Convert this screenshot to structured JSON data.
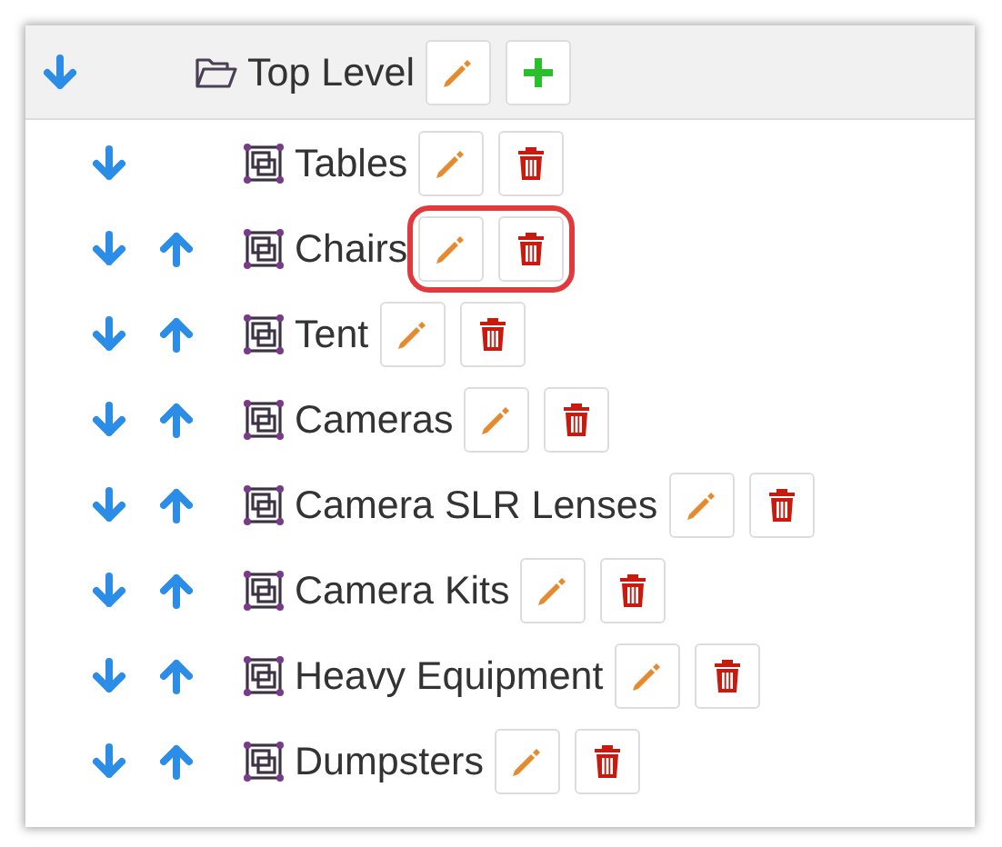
{
  "root": {
    "label": "Top Level",
    "expanded": true,
    "items": [
      {
        "label": "Tables",
        "can_move_up": false,
        "highlighted": false
      },
      {
        "label": "Chairs",
        "can_move_up": true,
        "highlighted": true
      },
      {
        "label": "Tent",
        "can_move_up": true,
        "highlighted": false
      },
      {
        "label": "Cameras",
        "can_move_up": true,
        "highlighted": false
      },
      {
        "label": "Camera SLR Lenses",
        "can_move_up": true,
        "highlighted": false
      },
      {
        "label": "Camera Kits",
        "can_move_up": true,
        "highlighted": false
      },
      {
        "label": "Heavy Equipment",
        "can_move_up": true,
        "highlighted": false
      },
      {
        "label": "Dumpsters",
        "can_move_up": true,
        "highlighted": false
      }
    ]
  }
}
